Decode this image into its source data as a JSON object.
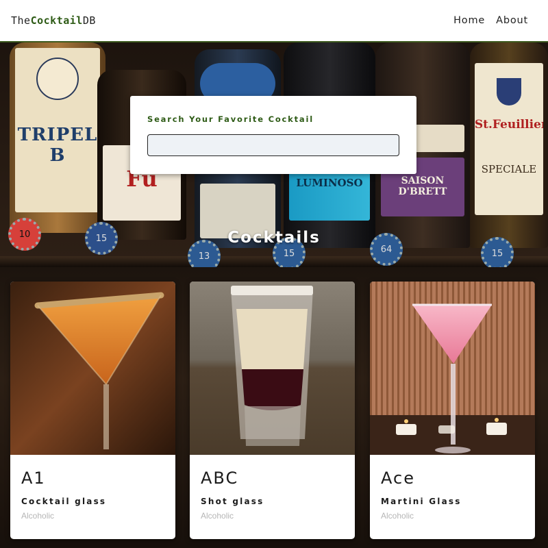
{
  "navbar": {
    "logo_prefix": "The",
    "logo_brand": "Cocktail",
    "logo_suffix": "DB",
    "links": [
      "Home",
      "About"
    ]
  },
  "background": {
    "bottle_labels": [
      "TRIPEL B",
      "Fu",
      "LUMINOSO",
      "SAISON D'BRETT",
      "St.Feuillien",
      "SPECIALE"
    ],
    "cap_numbers": [
      "10",
      "15",
      "13",
      "15",
      "64",
      "15"
    ]
  },
  "search": {
    "label": "Search Your Favorite Cocktail",
    "value": "",
    "placeholder": ""
  },
  "section_title": "Cocktails",
  "cocktails": [
    {
      "name": "A1",
      "glass": "Cocktail glass",
      "type": "Alcoholic",
      "image": "orange-martini-sugar-rim"
    },
    {
      "name": "ABC",
      "glass": "Shot glass",
      "type": "Alcoholic",
      "image": "layered-shot-cream-red"
    },
    {
      "name": "Ace",
      "glass": "Martini Glass",
      "type": "Alcoholic",
      "image": "pink-martini-candles"
    }
  ],
  "colors": {
    "brand_green": "#2e5b16",
    "navbar_bg": "#ffffff",
    "input_bg": "#eef2f6",
    "muted_text": "#b5b5b5"
  }
}
